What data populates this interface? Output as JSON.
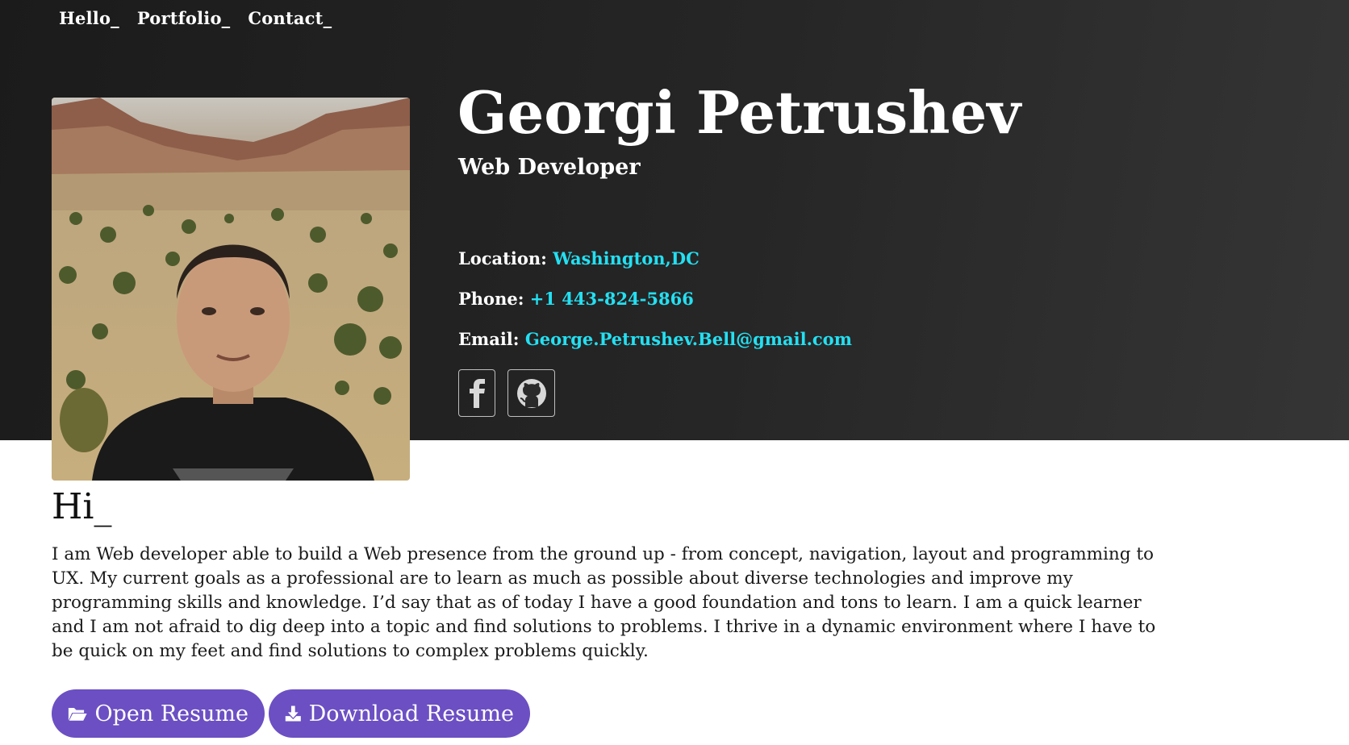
{
  "nav": {
    "items": [
      "Hello_",
      "Portfolio_",
      "Contact_"
    ]
  },
  "profile": {
    "name": "Georgi Petrushev",
    "role": "Web Developer",
    "photo_icon": "profile-photo"
  },
  "contact": {
    "location_label": "Location:",
    "location_value": "Washington,DC",
    "phone_label": "Phone:",
    "phone_value": "+1 443-824-5866",
    "email_label": "Email:",
    "email_value": "George.Petrushev.Bell@gmail.com"
  },
  "social": {
    "icons": [
      "facebook-icon",
      "github-icon"
    ]
  },
  "about": {
    "heading": "Hi_",
    "text": "I am Web developer able to build a Web presence from the ground up - from concept, navigation, layout and programming to UX. My current goals as a professional are to learn as much as possible about diverse technologies and improve my programming skills and knowledge. I’d say that as of today I have a good foundation and tons to learn. I am a quick learner and I am not afraid to dig deep into a topic and find solutions to problems. I thrive in a dynamic environment where I have to be quick on my feet and find solutions to complex problems quickly."
  },
  "buttons": {
    "open_resume": "Open Resume",
    "download_resume": "Download Resume"
  },
  "colors": {
    "accent": "#23e0f2",
    "button": "#6b4fc3",
    "hero_bg": "#262626"
  }
}
